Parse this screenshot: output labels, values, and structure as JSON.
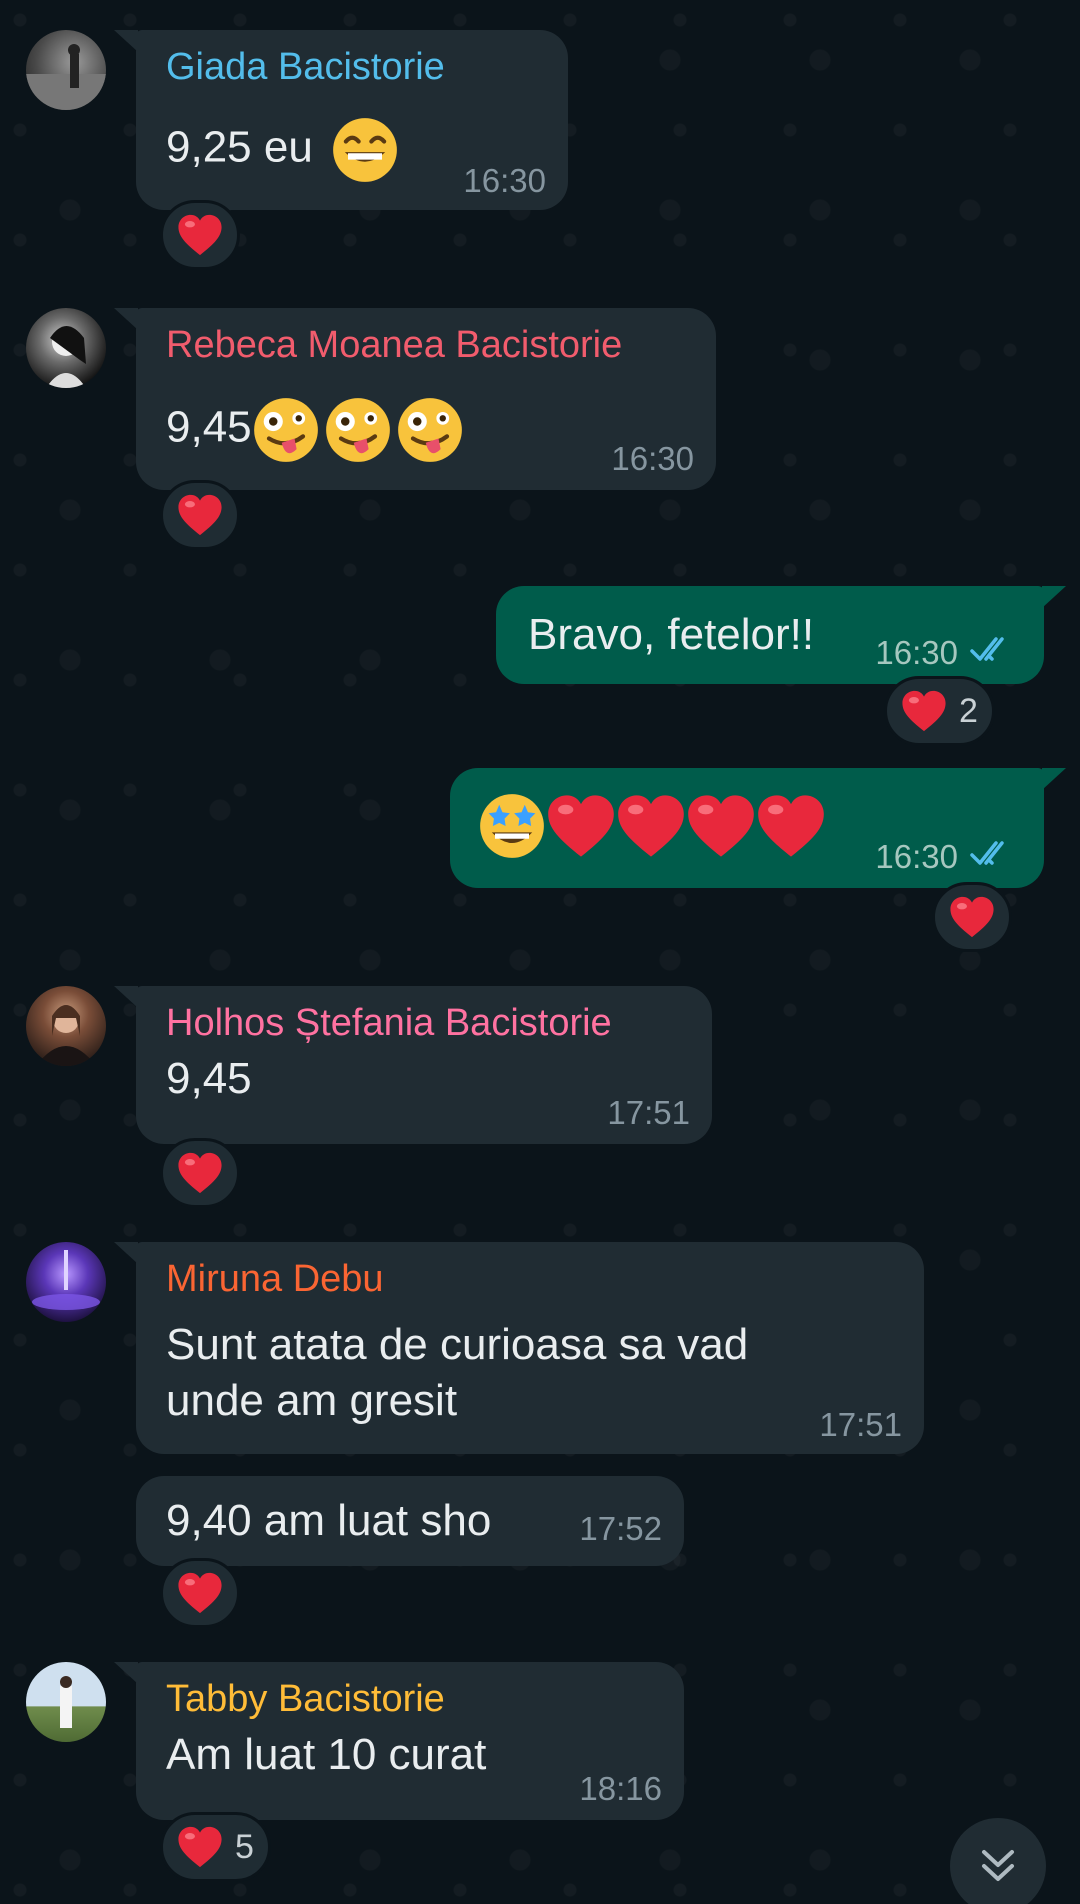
{
  "messages": [
    {
      "sender": "Giada Bacistorie",
      "sender_color": "#53bdeb",
      "text": "9,25 eu",
      "time": "16:30",
      "reaction_count": ""
    },
    {
      "sender": "Rebeca Moanea Bacistorie",
      "sender_color": "#f15c6d",
      "text": "9,45",
      "time": "16:30",
      "reaction_count": ""
    },
    {
      "sender": "",
      "text": "Bravo, fetelor!!",
      "time": "16:30",
      "reaction_count": "2"
    },
    {
      "sender": "",
      "text": "",
      "time": "16:30",
      "reaction_count": ""
    },
    {
      "sender": "Holhos Ștefania Bacistorie",
      "sender_color": "#ff72a1",
      "text": "9,45",
      "time": "17:51",
      "reaction_count": ""
    },
    {
      "sender": "Miruna Debu",
      "sender_color": "#fa6533",
      "text_line1": "Sunt atata de curioasa sa vad",
      "text_line2": "unde am gresit",
      "time": "17:51"
    },
    {
      "sender": "",
      "text": "9,40 am luat sho",
      "time": "17:52",
      "reaction_count": ""
    },
    {
      "sender": "Tabby Bacistorie",
      "sender_color": "#ffbc38",
      "text": "Am luat 10 curat",
      "time": "18:16",
      "reaction_count": "5"
    }
  ],
  "colors": {
    "background": "#0b141a",
    "incoming_bubble": "#202c33",
    "outgoing_bubble": "#005c4b",
    "read_ticks": "#53bdeb",
    "heart": "#e8283c"
  },
  "icons": {
    "reaction": "red-heart-icon",
    "read_receipt": "double-check-icon",
    "scroll": "double-chevron-down-icon"
  }
}
